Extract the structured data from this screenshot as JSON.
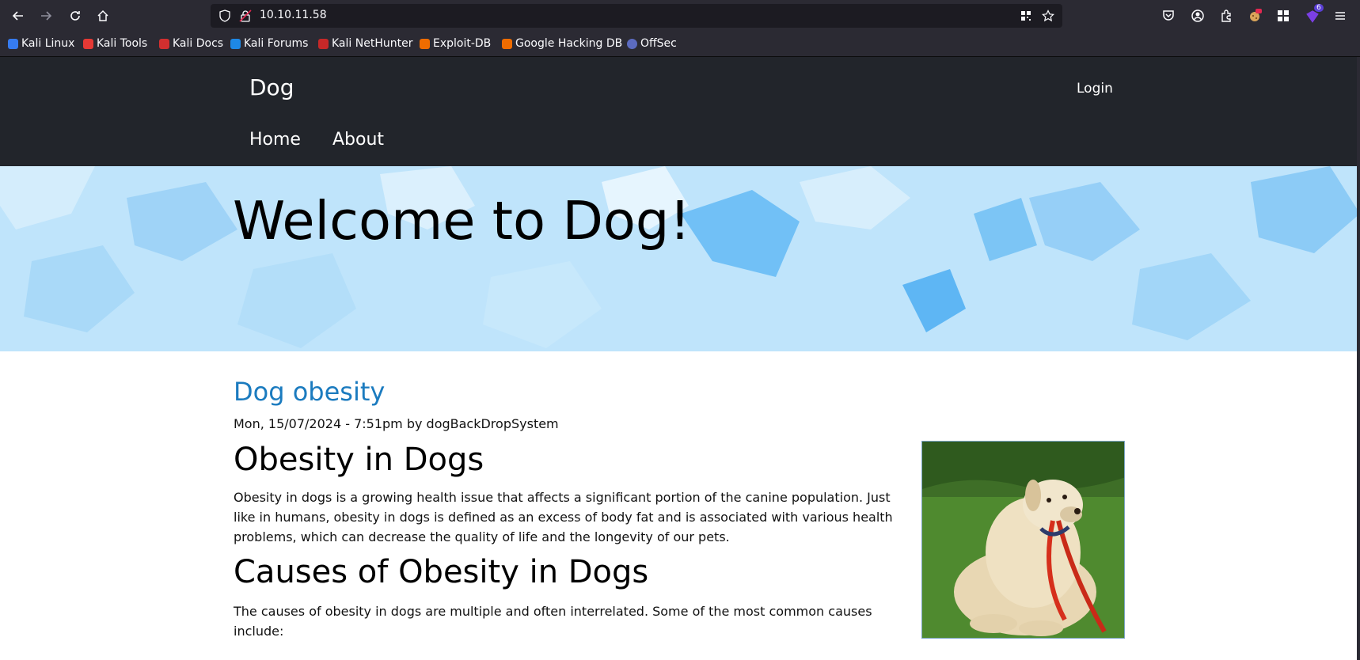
{
  "browser": {
    "url": "10.10.11.58",
    "extensions_badge": "6",
    "bookmarks": [
      {
        "label": "Kali Linux",
        "color": "#367bf0"
      },
      {
        "label": "Kali Tools",
        "color": "#e53935"
      },
      {
        "label": "Kali Docs",
        "color": "#d32f2f"
      },
      {
        "label": "Kali Forums",
        "color": "#1e88e5"
      },
      {
        "label": "Kali NetHunter",
        "color": "#c62828"
      },
      {
        "label": "Exploit-DB",
        "color": "#ef6c00"
      },
      {
        "label": "Google Hacking DB",
        "color": "#ef6c00"
      },
      {
        "label": "OffSec",
        "color": "#5c6bc0"
      }
    ]
  },
  "site": {
    "name": "Dog",
    "login": "Login",
    "nav": [
      "Home",
      "About"
    ],
    "hero_title": "Welcome to Dog!"
  },
  "post": {
    "title": "Dog obesity",
    "meta": "Mon, 15/07/2024 - 7:51pm by dogBackDropSystem",
    "h2_1": "Obesity in Dogs",
    "p1": "Obesity in dogs is a growing health issue that affects a significant portion of the canine population. Just like in humans, obesity in dogs is defined as an excess of body fat and is associated with various health problems, which can decrease the quality of life and the longevity of our pets.",
    "h2_2": "Causes of Obesity in Dogs",
    "p2": "The causes of obesity in dogs are multiple and often interrelated. Some of the most common causes include:"
  },
  "colors": {
    "chrome": "#2b2a33",
    "header": "#22252b",
    "link": "#1b7bbf",
    "hero": "#bfe4fb"
  }
}
